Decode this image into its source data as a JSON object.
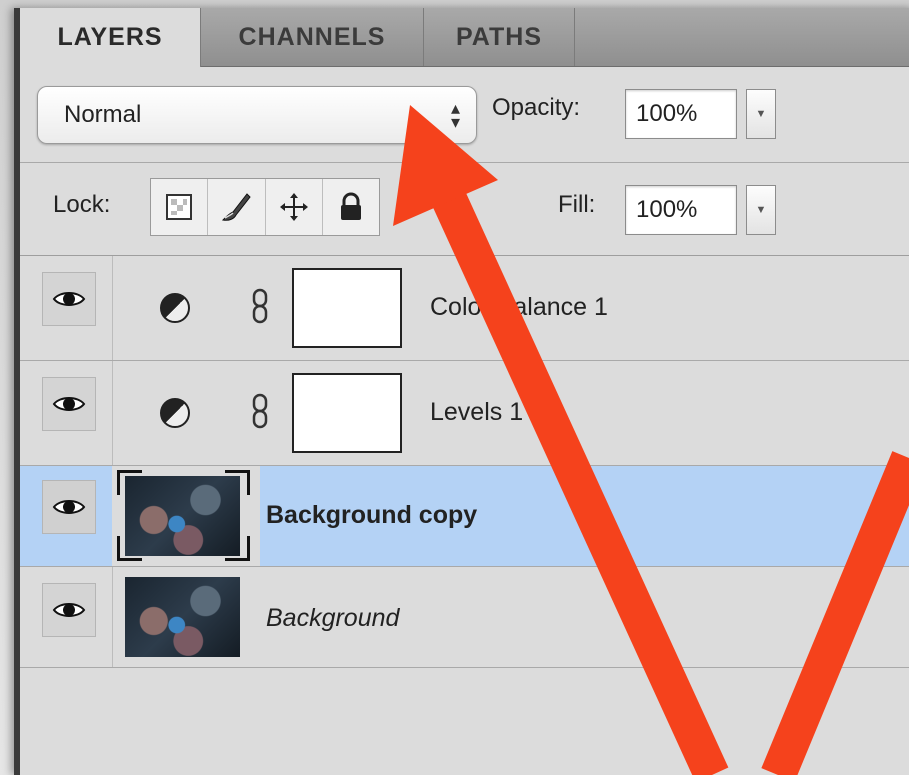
{
  "tabs": [
    {
      "label": "LAYERS",
      "active": true
    },
    {
      "label": "CHANNELS",
      "active": false
    },
    {
      "label": "PATHS",
      "active": false
    }
  ],
  "blend_mode": {
    "value": "Normal"
  },
  "opacity": {
    "label": "Opacity:",
    "value": "100%"
  },
  "lock": {
    "label": "Lock:",
    "icons": [
      "lock-transparent-pixels-icon",
      "lock-image-pixels-icon",
      "lock-position-icon",
      "lock-all-icon"
    ]
  },
  "fill": {
    "label": "Fill:",
    "value": "100%"
  },
  "layers": [
    {
      "name": "Color Balance 1",
      "type": "adjustment",
      "visible": true,
      "selected": false
    },
    {
      "name": "Levels 1",
      "type": "adjustment",
      "visible": true,
      "selected": false
    },
    {
      "name": "Background copy",
      "type": "image",
      "visible": true,
      "selected": true
    },
    {
      "name": "Background",
      "type": "image",
      "visible": true,
      "selected": false,
      "italic": true
    }
  ],
  "colors": {
    "selection": "#b4d2f5",
    "annotation_arrow": "#f5421c",
    "panel_bg": "#dcdcdc"
  }
}
